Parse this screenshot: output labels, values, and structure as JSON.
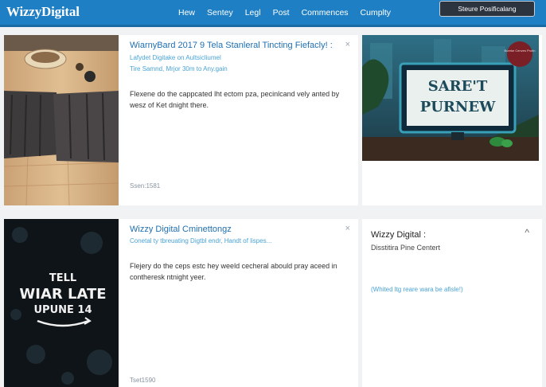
{
  "brand": {
    "name": "WizzyDigital"
  },
  "nav": {
    "items": [
      "Hew",
      "Sentey",
      "Legl",
      "Post",
      "Commences",
      "Cumplty"
    ],
    "cta": "Steure Posificalang"
  },
  "articles": [
    {
      "title": "WiarnyBard 2017 9 Tela Stanleral Tincting Fiefacly! :",
      "source": "Lafydet Digitake on Aultsicliumel",
      "meta": "Tire Samnd, Mrjor 30m to Any.gain",
      "body": "Flexene do the cappcated lht ectom pza, pecinlcand vely anted by wesz of Ket dnight there.",
      "count": "Ssen:1581"
    },
    {
      "title": "Wizzy Digital Cminettongz",
      "meta": "Conetal ty tbreuating Digtbl endr, Handt of lispes...",
      "body": "Flejery do the ceps estc hey weeld cecheral abould pray aceed in contheresk ntnight yeer.",
      "count": "Tset1590"
    }
  ],
  "promo": {
    "sign_line1": "SARE'T",
    "sign_line2": "PURNEW",
    "badge": "Bureke Cenves Proitn"
  },
  "book": {
    "line1": "TELL",
    "line2": "WIAR LATE",
    "line3": "UPUNE 14"
  },
  "sidebar": {
    "title": "Wizzy Digital :",
    "subtitle": "Disstitira Pine Centert",
    "link": "(Whited ltg reare wara be afisle!)"
  },
  "icons": {
    "close": "×",
    "caret": "^"
  },
  "colors": {
    "brand_blue": "#1f7fc4",
    "link_blue": "#1f6fb2",
    "meta_blue": "#4aa3d6"
  }
}
